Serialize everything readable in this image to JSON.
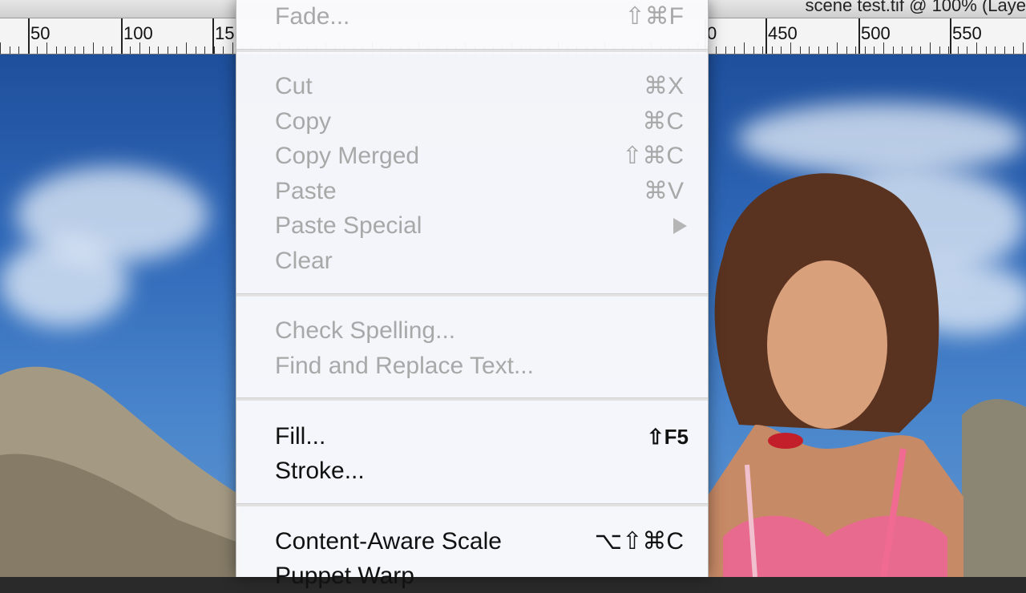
{
  "document": {
    "title": "scene test.tif @ 100% (Laye"
  },
  "ruler": {
    "labels": [
      "50",
      "100",
      "15",
      "0",
      "450",
      "500",
      "550"
    ]
  },
  "menu": {
    "items": [
      {
        "label": "Fade...",
        "shortcut": "⇧⌘F",
        "enabled": false
      },
      {
        "label": "Cut",
        "shortcut": "⌘X",
        "enabled": false
      },
      {
        "label": "Copy",
        "shortcut": "⌘C",
        "enabled": false
      },
      {
        "label": "Copy Merged",
        "shortcut": "⇧⌘C",
        "enabled": false
      },
      {
        "label": "Paste",
        "shortcut": "⌘V",
        "enabled": false
      },
      {
        "label": "Paste Special",
        "shortcut": "",
        "submenu": true,
        "enabled": false
      },
      {
        "label": "Clear",
        "shortcut": "",
        "enabled": false
      },
      {
        "label": "Check Spelling...",
        "shortcut": "",
        "enabled": false
      },
      {
        "label": "Find and Replace Text...",
        "shortcut": "",
        "enabled": false
      },
      {
        "label": "Fill...",
        "shortcut": "⇧F5",
        "enabled": true
      },
      {
        "label": "Stroke...",
        "shortcut": "",
        "enabled": true
      },
      {
        "label": "Content-Aware Scale",
        "shortcut": "⌥⇧⌘C",
        "enabled": true
      },
      {
        "label": "Puppet Warp",
        "shortcut": "",
        "enabled": true
      }
    ]
  }
}
